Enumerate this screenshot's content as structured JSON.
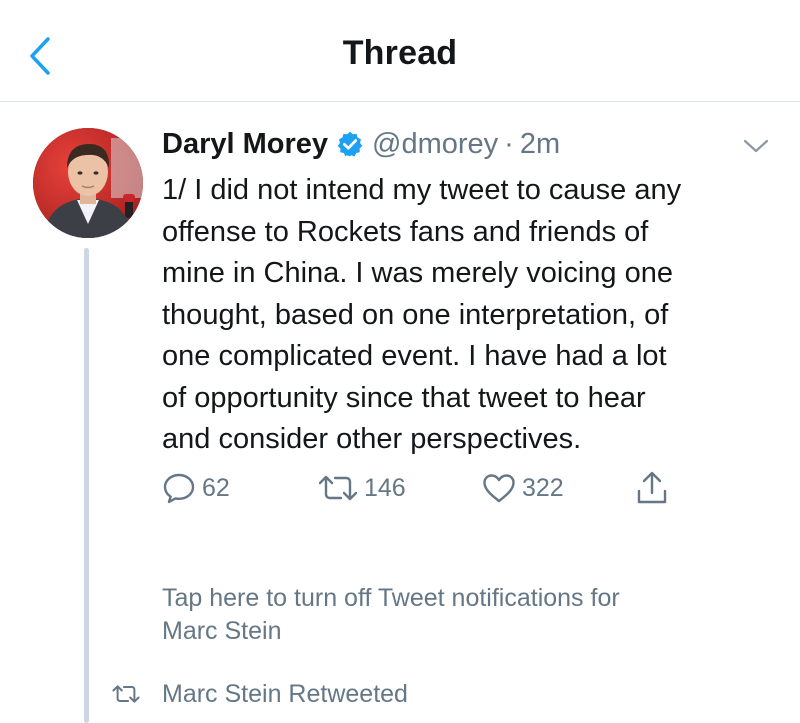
{
  "header": {
    "title": "Thread",
    "back_icon": "chevron-left-icon",
    "accent_color": "#1da1f2"
  },
  "tweet": {
    "author": {
      "display_name": "Daryl Morey",
      "verified": true,
      "handle": "@dmorey",
      "separator": "·",
      "timestamp": "2m"
    },
    "text_lines": [
      "1/ I did not intend my tweet to cause any",
      "offense to Rockets fans and friends of",
      "mine in China. I was merely voicing one",
      "thought, based on one interpretation, of",
      "one complicated event. I have had a lot",
      "of opportunity since that tweet to hear",
      "and consider other perspectives."
    ],
    "actions": {
      "replies": "62",
      "retweets": "146",
      "likes": "322"
    },
    "menu_icon": "chevron-down-icon"
  },
  "notification": {
    "lines": [
      "Tap here to turn off Tweet notifications for",
      "Marc Stein"
    ]
  },
  "retweet_context": {
    "label": "Marc Stein Retweeted",
    "icon": "retweet-icon"
  },
  "colors": {
    "text_primary": "#14171a",
    "text_secondary": "#657786",
    "verified_blue": "#1da1f2",
    "divider": "#e1e8ed",
    "thread_line": "#cdd6e3"
  }
}
